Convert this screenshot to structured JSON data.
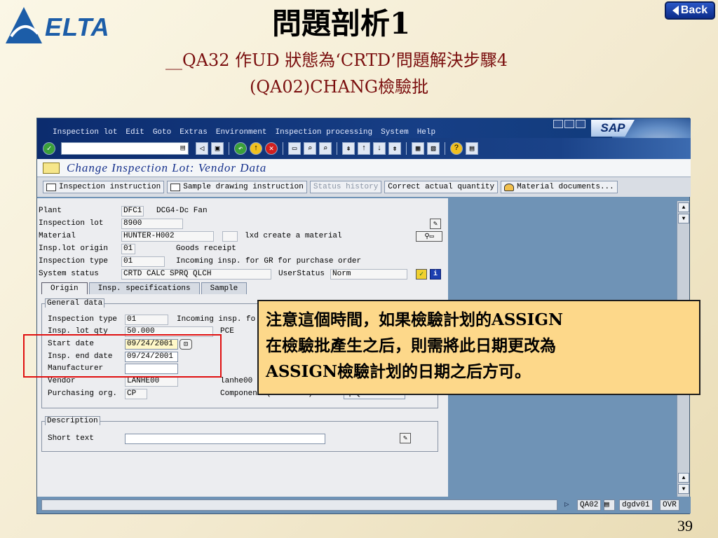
{
  "slide": {
    "logo_text": "ELTA",
    "title": "問題剖析1",
    "subtitle_line1": "__QA32 作UD 狀態為‘CRTD’問題解決步驟4",
    "subtitle_line2": "(QA02)CHANG檢驗批",
    "back_label": "Back",
    "page_number": "39"
  },
  "sap": {
    "menu": [
      "Inspection lot",
      "Edit",
      "Goto",
      "Extras",
      "Environment",
      "Inspection processing",
      "System",
      "Help"
    ],
    "logo": "SAP",
    "screen_title": "Change Inspection Lot: Vendor Data",
    "app_buttons": [
      "Inspection instruction",
      "Sample drawing instruction",
      "Status history",
      "Correct actual quantity",
      "Material documents..."
    ],
    "header": {
      "plant_label": "Plant",
      "plant_value": "DFC1",
      "plant_desc": "DCG4-Dc Fan",
      "lot_label": "Inspection lot",
      "lot_value": "8900",
      "material_label": "Material",
      "material_value": "HUNTER-H002",
      "material_desc": "lxd create a material",
      "origin_label": "Insp.lot origin",
      "origin_value": "01",
      "origin_desc": "Goods receipt",
      "type_label": "Inspection type",
      "type_value": "01",
      "type_desc": "Incoming insp. for GR for purchase order",
      "status_label": "System status",
      "status_value": "CRTD CALC SPRQ QLCH",
      "userstatus_label": "UserStatus",
      "userstatus_value": "Norm"
    },
    "tabs": [
      "Origin",
      "Insp. specifications",
      "Sample"
    ],
    "general_data": {
      "title": "General data",
      "insp_type_label": "Inspection type",
      "insp_type_value": "01",
      "insp_type_desc": "Incoming insp. fo",
      "lot_qty_label": "Insp. lot qty",
      "lot_qty_value": "50.000",
      "lot_qty_unit": "PCE",
      "start_label": "Start date",
      "start_value": "09/24/2001",
      "end_label": "Insp. end date",
      "end_value": "09/24/2001",
      "manufacturer_label": "Manufacturer",
      "vendor_label": "Vendor",
      "vendor_value": "LANHE00",
      "vendor_desc": "lanhe00",
      "purch_label": "Purchasing org.",
      "purch_value": "CP",
      "components_label": "Components(Raw M'TL)",
      "qinfo_label": "Q-info ..."
    },
    "description": {
      "title": "Description",
      "short_text_label": "Short text",
      "short_text_value": ""
    },
    "status_bar": [
      "QA02",
      "dgdv01",
      "OVR"
    ]
  },
  "callout": {
    "line1": "注意這個時間，如果檢驗計划的ASSIGN",
    "line2": "在檢驗批產生之后，則需將此日期更改為",
    "line3": "ASSIGN檢驗計划的日期之后方可。"
  },
  "colors": {
    "slide_bg": "#f3ead0",
    "sap_frame": "#6f93b6",
    "sap_header": "#0c2c6e",
    "callout_bg": "#fdd88a",
    "highlight_box": "#e01010",
    "subtitle": "#7a0e0e"
  }
}
